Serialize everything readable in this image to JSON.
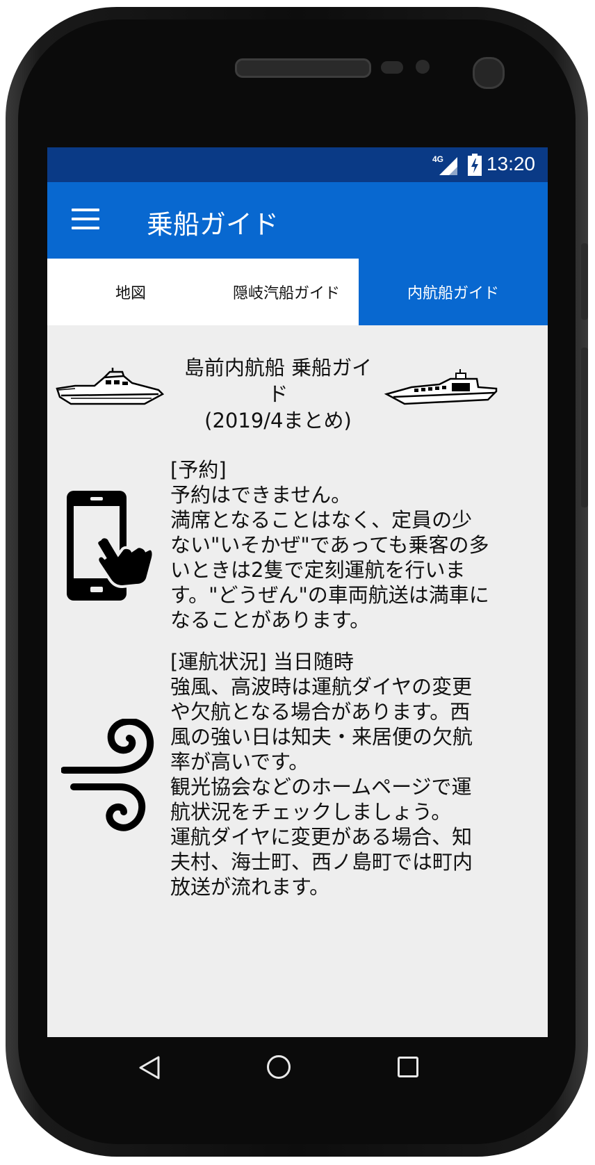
{
  "status_bar": {
    "network": "4G",
    "time": "13:20"
  },
  "app_bar": {
    "title": "乗船ガイド"
  },
  "tabs": [
    {
      "label": "地図",
      "active": false
    },
    {
      "label": "隠岐汽船ガイド",
      "active": false
    },
    {
      "label": "内航船ガイド",
      "active": true
    }
  ],
  "guide": {
    "title_lines": [
      "島前内航船 乗船ガイ",
      "ド",
      "(2019/4まとめ)"
    ],
    "left_icon": "speedboat-icon",
    "right_icon": "ferry-icon"
  },
  "sections": [
    {
      "icon": "phone-tap-icon",
      "lines": [
        "[予約]",
        "予約はできません。",
        "満席となることはなく、定員の少",
        "ない\"いそかぜ\"であっても乗客の多",
        "いときは2隻で定刻運航を行いま",
        "す。\"どうぜん\"の車両航送は満車に",
        "なることがあります。"
      ]
    },
    {
      "icon": "wind-icon",
      "lines": [
        "[運航状況] 当日随時",
        "強風、高波時は運航ダイヤの変更",
        "や欠航となる場合があります。西",
        "風の強い日は知夫・来居便の欠航",
        "率が高いです。",
        "観光協会などのホームページで運",
        "航状況をチェックしましょう。",
        "運航ダイヤに変更がある場合、知",
        "夫村、海士町、西ノ島町では町内",
        "放送が流れます。"
      ]
    }
  ],
  "nav_bar": {
    "back": "back-icon",
    "home": "home-icon",
    "recents": "recents-icon"
  },
  "colors": {
    "status_bar": "#0a3a86",
    "app_bar": "#0868d0",
    "active_tab": "#0868d0",
    "content_bg": "#eeeeee"
  }
}
